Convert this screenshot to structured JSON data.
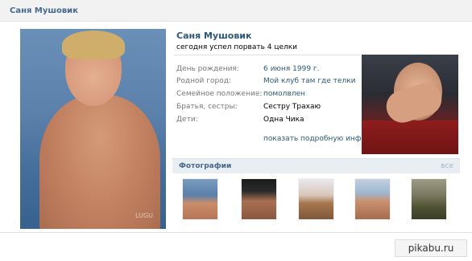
{
  "header": {
    "title": "Саня Мушовик"
  },
  "profile": {
    "name": "Саня Мушовик",
    "status": "сегодня успел порвать 4 целки",
    "info": [
      {
        "label": "День рождения:",
        "value": "6 июня 1999 г.",
        "link": true
      },
      {
        "label": "Родной город:",
        "value": "Мой клуб там где телки",
        "link": true
      },
      {
        "label": "Семейное положение:",
        "value": "помолвлен",
        "link": true
      },
      {
        "label": "Братья, сестры:",
        "value": "Сестру Трахаю",
        "link": false
      },
      {
        "label": "Дети:",
        "value": "Одна Чика",
        "link": false
      }
    ],
    "more_link": "показать подробную инфо"
  },
  "photos": {
    "header": "Фотографии",
    "all_link": "все"
  },
  "watermark": {
    "avatar": "LUGU",
    "site": "pikabu.ru"
  },
  "colors": {
    "link": "#2b587a",
    "header_text": "#45688e",
    "label": "#777777"
  }
}
